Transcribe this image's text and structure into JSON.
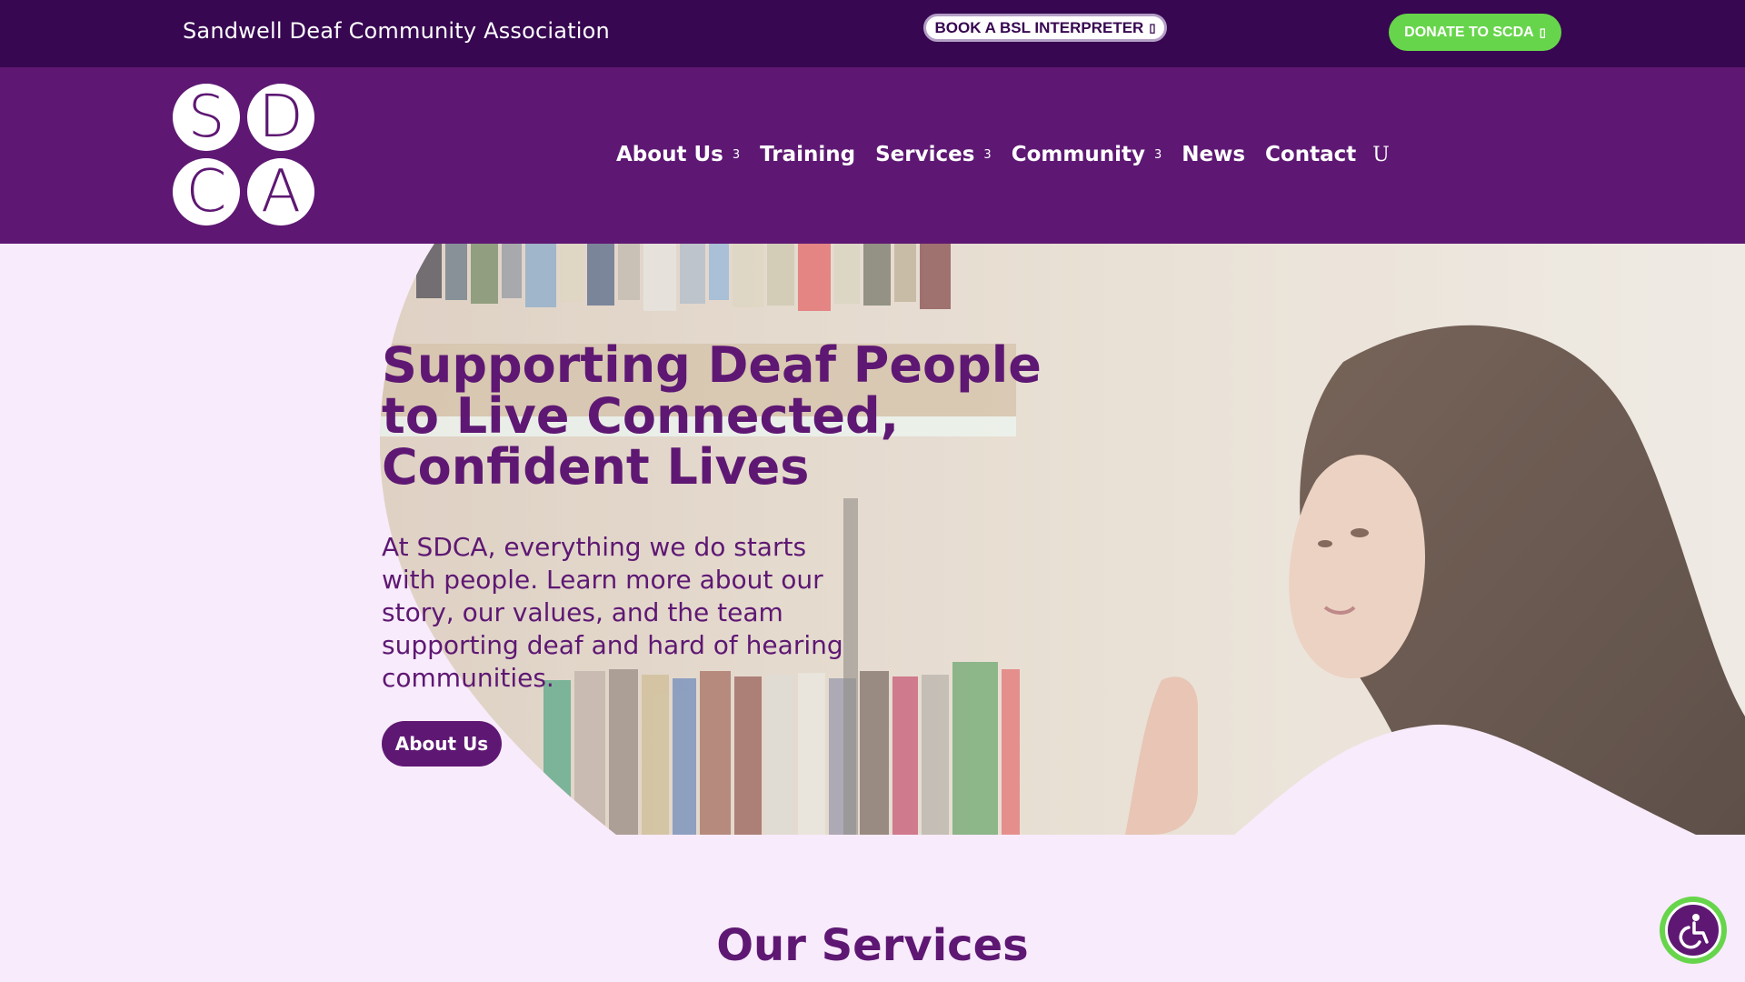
{
  "topbar": {
    "org_name": "Sandwell Deaf Community Association",
    "bsl_label": "BOOK A BSL INTERPRETER",
    "donate_label": "DONATE TO SCDA",
    "button_icon": "arrow-icon"
  },
  "logo": {
    "letters": [
      "S",
      "D",
      "C",
      "A"
    ]
  },
  "nav": {
    "items": [
      {
        "label": "About Us",
        "has_dropdown": true
      },
      {
        "label": "Training",
        "has_dropdown": false
      },
      {
        "label": "Services",
        "has_dropdown": true
      },
      {
        "label": "Community",
        "has_dropdown": true
      },
      {
        "label": "News",
        "has_dropdown": false
      },
      {
        "label": "Contact",
        "has_dropdown": false
      }
    ],
    "dropdown_glyph": "3",
    "search_glyph": "U"
  },
  "hero": {
    "title": "Supporting Deaf People to Live Connected, Confident Lives",
    "text": "At SDCA, everything we do starts with people. Learn more about our story, our values, and the team supporting deaf and hard of hearing communities.",
    "button_label": "About Us"
  },
  "services": {
    "title": "Our Services"
  },
  "colors": {
    "topbar_bg": "#370751",
    "header_bg": "#5e1873",
    "accent_green": "#67d54b",
    "page_bg": "#f8ebfb",
    "primary_text": "#5e1873"
  }
}
